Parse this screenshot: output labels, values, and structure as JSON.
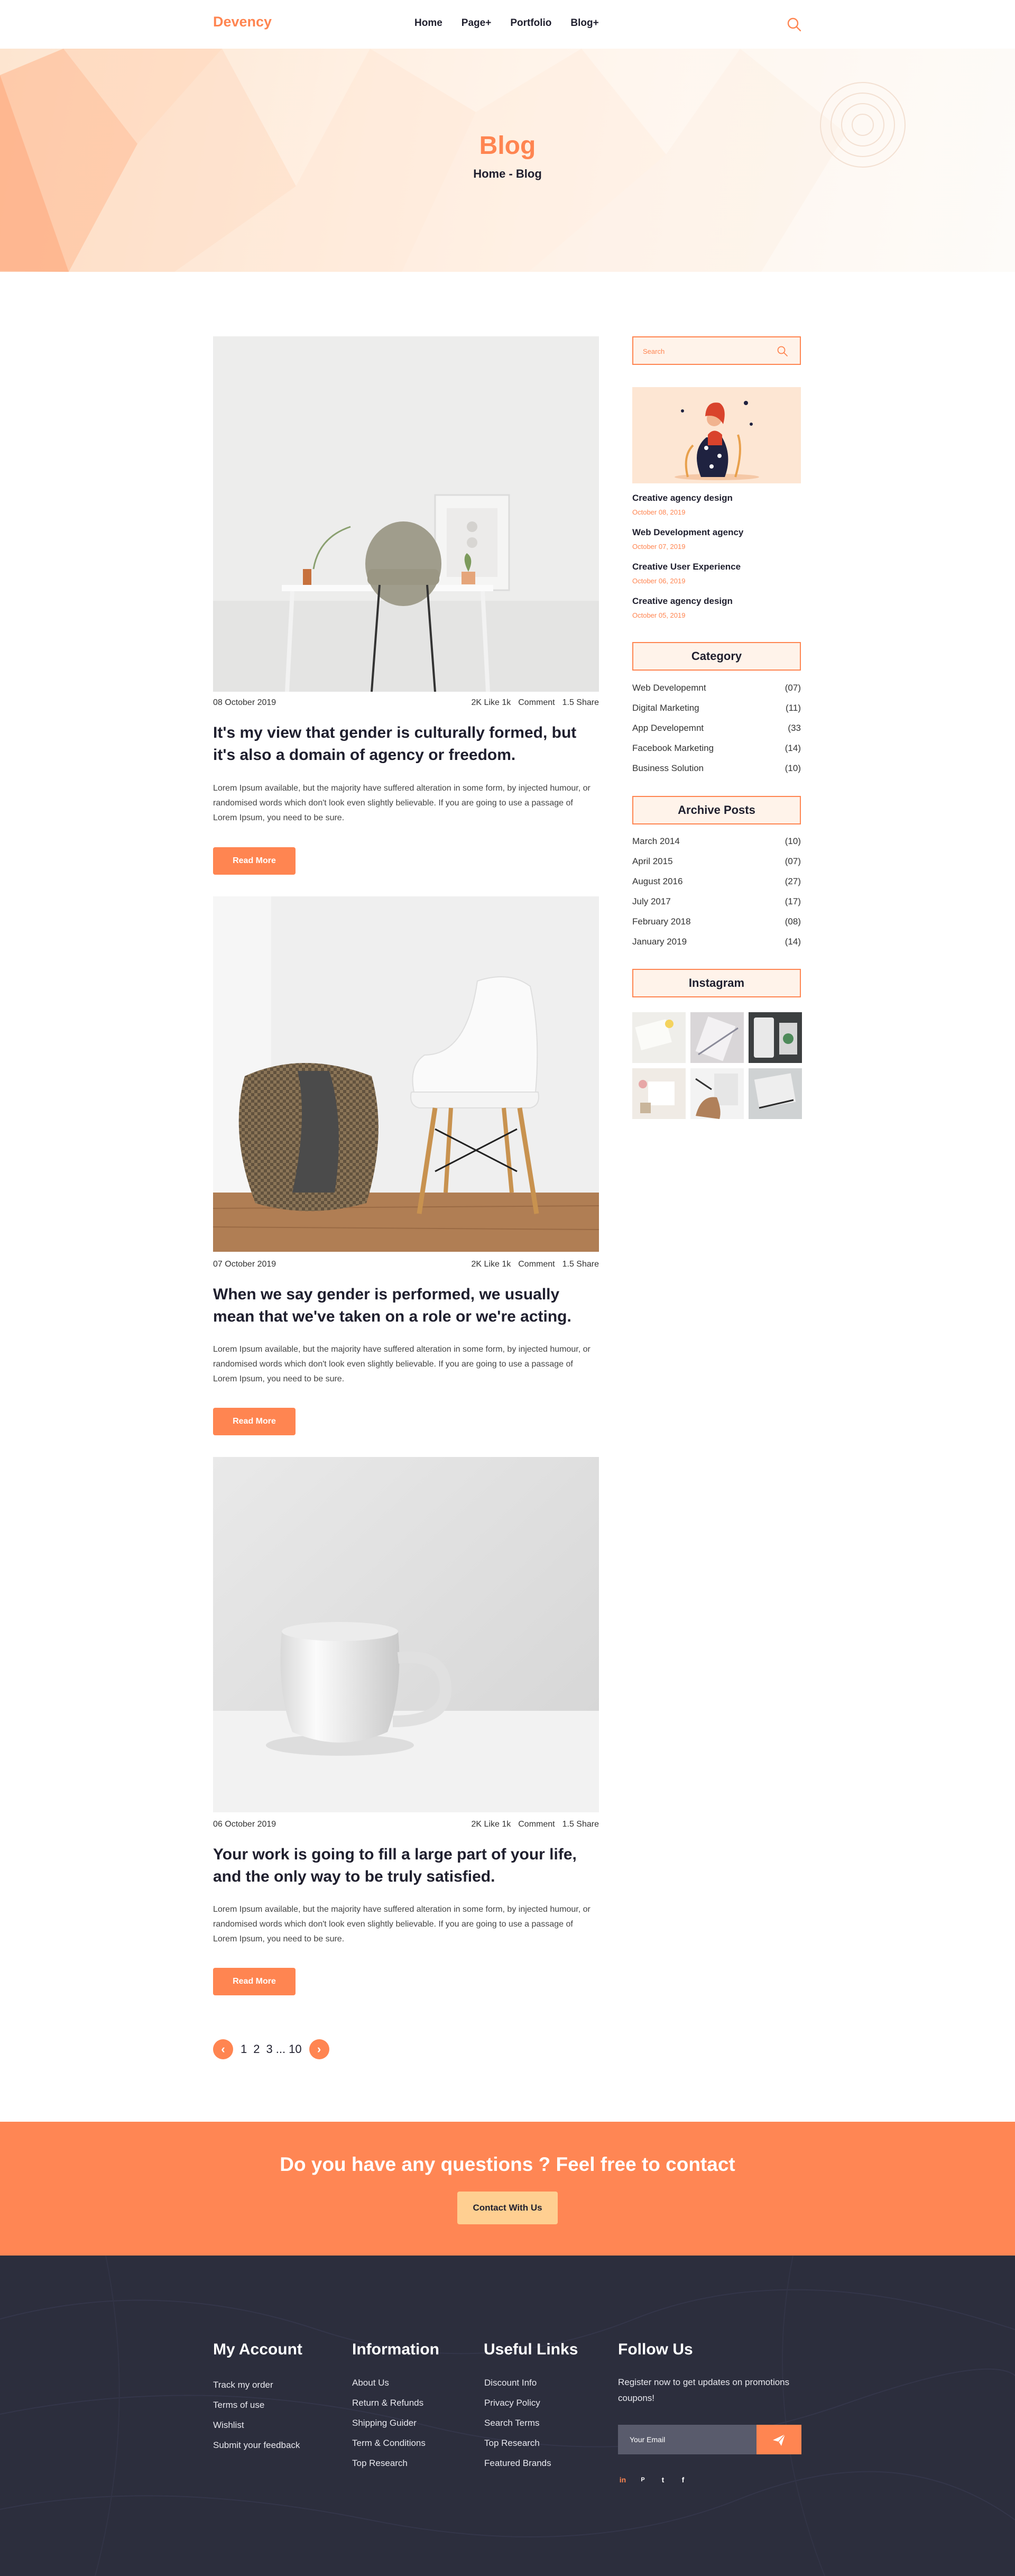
{
  "header": {
    "logo": "Devency",
    "nav": [
      "Home",
      "Page+",
      "Portfolio",
      "Blog+"
    ]
  },
  "banner": {
    "title": "Blog",
    "breadcrumb": "Home - Blog"
  },
  "posts": [
    {
      "date": "08 October 2019",
      "likes": "2K Like 1k",
      "comment": "Comment",
      "share": "1.5 Share",
      "title": "It's my view that gender is culturally formed, but it's also a domain of agency or freedom.",
      "excerpt": "Lorem Ipsum available, but the majority have suffered alteration in some form, by injected humour, or randomised words which don't look even slightly believable. If you are going to use a passage of Lorem Ipsum, you need to be sure.",
      "button": "Read More"
    },
    {
      "date": "07 October 2019",
      "likes": "2K Like 1k",
      "comment": "Comment",
      "share": "1.5 Share",
      "title": "When we say gender is performed, we usually mean that we've taken on a role or we're acting.",
      "excerpt": "Lorem Ipsum available, but the majority have suffered alteration in some form, by injected humour, or randomised words which don't look even slightly believable. If you are going to use a passage of Lorem Ipsum, you need to be sure.",
      "button": "Read More"
    },
    {
      "date": "06 October 2019",
      "likes": "2K Like 1k",
      "comment": "Comment",
      "share": "1.5 Share",
      "title": "Your work is going to fill a large part of your life, and the only way to be truly satisfied.",
      "excerpt": "Lorem Ipsum available, but the majority have suffered alteration in some form, by injected humour, or randomised words which don't look even slightly believable. If you are going to use a passage of Lorem Ipsum, you need to be sure.",
      "button": "Read More"
    }
  ],
  "pagination": {
    "prev": "‹",
    "pages": [
      "1",
      "2",
      "3",
      "...",
      "10"
    ],
    "next": "›"
  },
  "sidebar": {
    "search_placeholder": "Search",
    "recent": [
      {
        "title": "Creative agency design",
        "date": "October 08, 2019"
      },
      {
        "title": "Web Development agency",
        "date": "October 07, 2019"
      },
      {
        "title": "Creative User Experience",
        "date": "October 06, 2019"
      },
      {
        "title": "Creative agency design",
        "date": "October 05, 2019"
      }
    ],
    "category_heading": "Category",
    "categories": [
      {
        "name": "Web Developemnt",
        "count": "(07)"
      },
      {
        "name": "Digital Marketing",
        "count": "(11)"
      },
      {
        "name": "App Developemnt",
        "count": "(33"
      },
      {
        "name": "Facebook Marketing",
        "count": "(14)"
      },
      {
        "name": "Business Solution",
        "count": "(10)"
      }
    ],
    "archive_heading": "Archive Posts",
    "archives": [
      {
        "name": "March 2014",
        "count": "(10)"
      },
      {
        "name": "April 2015",
        "count": "(07)"
      },
      {
        "name": "August 2016",
        "count": "(27)"
      },
      {
        "name": "July 2017",
        "count": "(17)"
      },
      {
        "name": "February 2018",
        "count": "(08)"
      },
      {
        "name": "January 2019",
        "count": "(14)"
      }
    ],
    "instagram_heading": "Instagram"
  },
  "cta": {
    "title": "Do you have any questions ? Feel free to contact",
    "button": "Contact With Us"
  },
  "footer": {
    "my_account": {
      "heading": "My Account",
      "links": [
        "Track my order",
        "Terms of use",
        "Wishlist",
        "Submit your feedback"
      ]
    },
    "information": {
      "heading": "Information",
      "links": [
        "About Us",
        "Return & Refunds",
        "Shipping Guider",
        "Term & Conditions",
        "Top Research"
      ]
    },
    "useful_links": {
      "heading": "Useful Links",
      "links": [
        "Discount Info",
        "Privacy Policy",
        "Search Terms",
        "Top Research",
        "Featured Brands"
      ]
    },
    "follow_us": {
      "heading": "Follow Us",
      "text": "Register now to get updates on promotions coupons!",
      "email_placeholder": "Your Email",
      "socials": [
        "in",
        "P",
        "t",
        "f"
      ]
    }
  },
  "colors": {
    "accent": "#ff8551",
    "dark": "#1f1f2e",
    "footer_bg": "#2c2e3d",
    "cta_button": "#ffcf91"
  }
}
